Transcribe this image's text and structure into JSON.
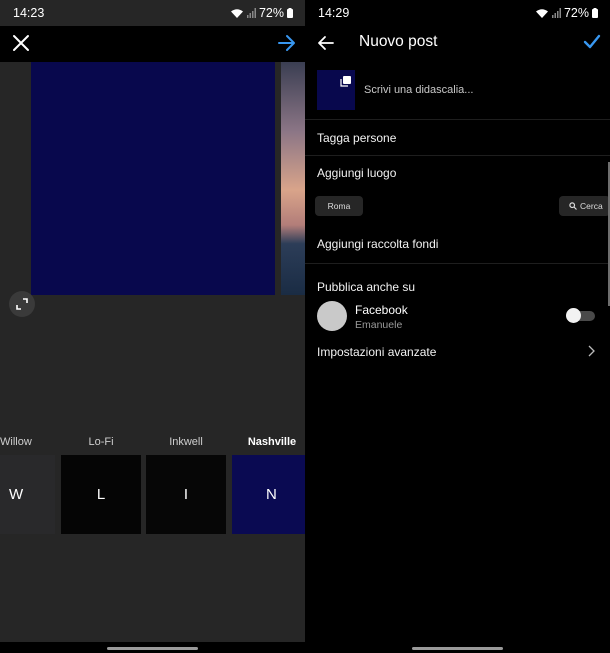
{
  "left_screen": {
    "status": {
      "time": "14:23",
      "battery": "72%"
    },
    "filters": [
      {
        "label": "Willow",
        "letter": "W",
        "thumb_color": "#29292b",
        "active": false
      },
      {
        "label": "Lo-Fi",
        "letter": "L",
        "thumb_color": "#050505",
        "active": false
      },
      {
        "label": "Inkwell",
        "letter": "I",
        "thumb_color": "#060606",
        "active": false
      },
      {
        "label": "Nashville",
        "letter": "N",
        "thumb_color": "#0a0a52",
        "active": true
      }
    ],
    "icons": [
      "close-icon",
      "next-arrow-icon",
      "expand-icon"
    ]
  },
  "right_screen": {
    "status": {
      "time": "14:29",
      "battery": "72%"
    },
    "header": {
      "title": "Nuovo post"
    },
    "caption_placeholder": "Scrivi una didascalia...",
    "tag_people": "Tagga persone",
    "add_location": "Aggiungi luogo",
    "location_chip": "Roma",
    "search_chip": "Cerca",
    "add_fundraiser": "Aggiungi raccolta fondi",
    "also_post_on": "Pubblica anche su",
    "facebook": {
      "name": "Facebook",
      "account": "Emanuele",
      "enabled": false
    },
    "advanced_settings": "Impostazioni avanzate",
    "icons": [
      "back-arrow-icon",
      "checkmark-icon",
      "search-icon",
      "chevron-right-icon"
    ]
  },
  "colors": {
    "accent": "#3897f0",
    "preview_blue": "#08084d"
  }
}
